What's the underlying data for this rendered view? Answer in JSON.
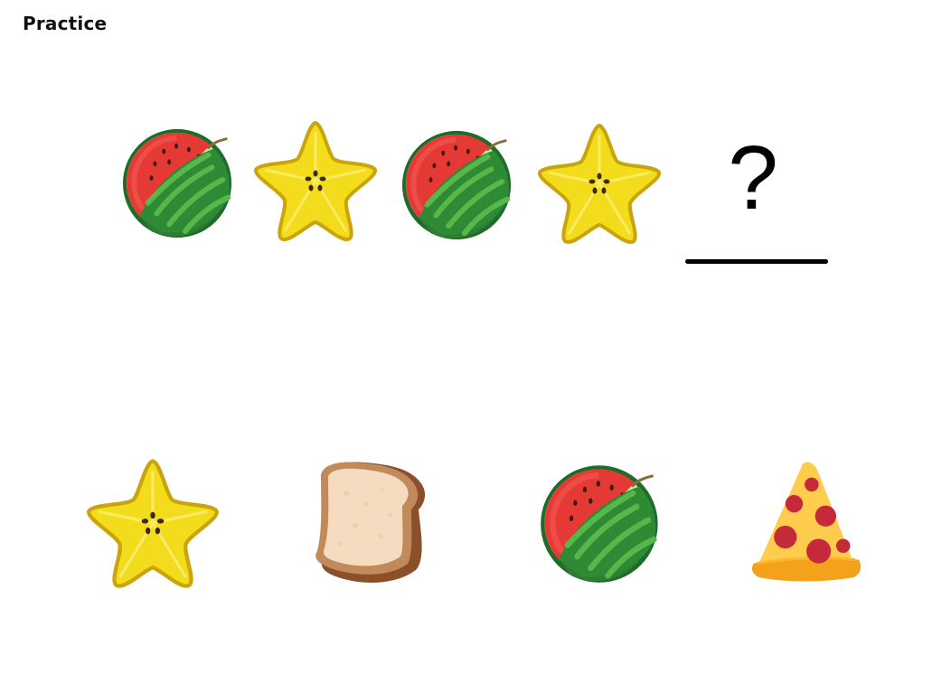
{
  "header": {
    "title": "Practice"
  },
  "pattern": {
    "items": [
      {
        "icon": "watermelon-icon"
      },
      {
        "icon": "starfruit-icon"
      },
      {
        "icon": "watermelon-icon"
      },
      {
        "icon": "starfruit-icon"
      }
    ],
    "blank_symbol": "?"
  },
  "options": [
    {
      "icon": "starfruit-icon"
    },
    {
      "icon": "bread-slice-icon"
    },
    {
      "icon": "watermelon-icon"
    },
    {
      "icon": "pizza-slice-icon"
    }
  ],
  "colors": {
    "watermelon_rind": "#2e7d32",
    "watermelon_flesh": "#e53935",
    "starfruit": "#f2dc1b",
    "bread": "#f5dcc0",
    "pizza": "#ffcc4d",
    "pepperoni": "#c62a3a"
  }
}
